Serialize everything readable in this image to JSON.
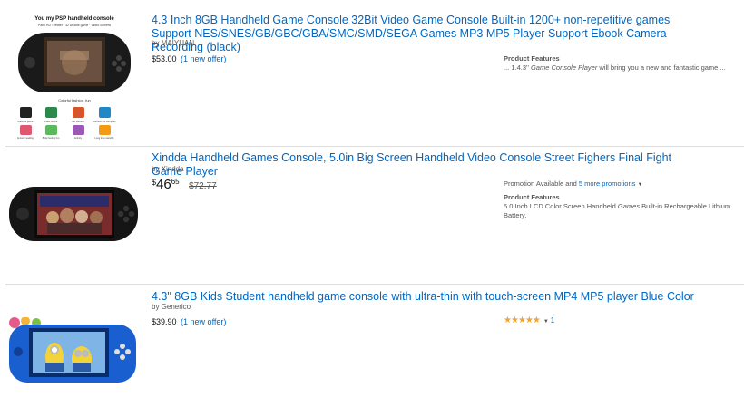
{
  "results": [
    {
      "title": "4.3 Inch 8GB Handheld Game Console 32Bit Video Game Console Built-in 1200+ non-repetitive games Support NES/SNES/GB/GBC/GBA/SMC/SMD/SEGA Games MP3 MP5 Player Support Ebook Camera Recording (black)",
      "byline": "by MAIYUAN",
      "price": "$53.00",
      "offer": "(1 new offer)",
      "features_label": "Product Features",
      "features_prefix": "... 1.4.3'' ",
      "features_italic": "Game Console Player",
      "features_suffix": " will bring you a new and fantastic game ...",
      "image": {
        "headline": "You my PSP handheld console",
        "subline": "Palm HD Theater · 32 arcade game · Video camera",
        "caption": "Colorful fashion, fun",
        "features": [
          "Massive game",
          "Video output",
          "HD camera",
          "Connect the computer",
          "E-book reading",
          "Body feeling fun",
          "Activity",
          "Long time standby"
        ]
      }
    },
    {
      "title": "Xindda Handheld Games Console, 5.0in Big Screen Handheld Video Console Street Fighers Final Fight Game Player",
      "byline": "by Xindda",
      "price_symbol": "$",
      "price_whole": "46",
      "price_fraction": "65",
      "old_price": "$72.77",
      "promo_text": "Promotion Available and ",
      "promo_link": "5 more promotions",
      "features_label": "Product Features",
      "features_prefix": "5.0 Inch LCD Color Screen Handheld ",
      "features_italic": "Games",
      "features_suffix": ".Built-in Rechargeable Lithium Battery."
    },
    {
      "title": "4.3\" 8GB Kids Student handheld game console with ultra-thin with touch-screen MP4 MP5 player Blue Color",
      "byline": "by Generico",
      "price": "$39.90",
      "offer": "(1 new offer)",
      "rating": 5,
      "review_count": "1"
    }
  ],
  "colors": {
    "link": "#0066c0",
    "star": "#f0a33b",
    "divider": "#dddddd",
    "console_blue": "#1a5fd0"
  }
}
